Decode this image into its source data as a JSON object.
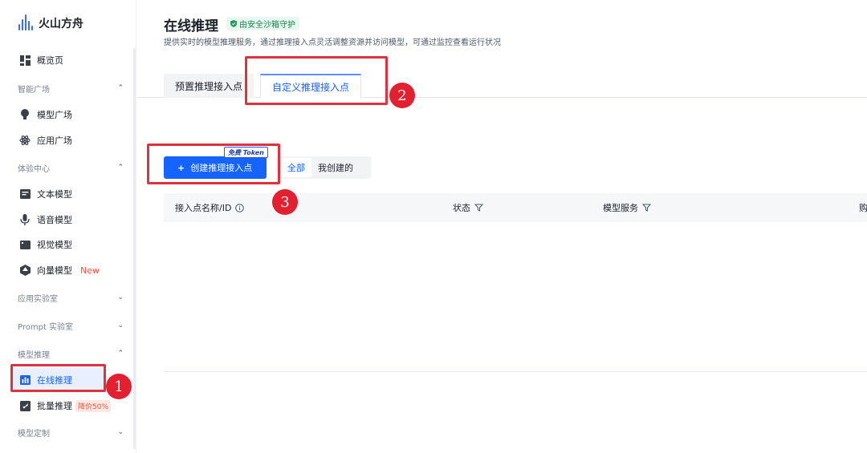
{
  "brand": {
    "name": "火山方舟"
  },
  "sidebar": {
    "overview": "概览页",
    "groups": [
      {
        "label": "智能广场",
        "chevron": "⌃"
      },
      {
        "label": "体验中心",
        "chevron": "⌃"
      },
      {
        "label": "应用实验室",
        "chevron": "⌄"
      },
      {
        "label": "Prompt 实验室",
        "chevron": "⌄"
      },
      {
        "label": "模型推理",
        "chevron": "⌃"
      },
      {
        "label": "模型定制",
        "chevron": "⌄"
      }
    ],
    "items": [
      {
        "label": "模型广场",
        "icon": "bulb-icon"
      },
      {
        "label": "应用广场",
        "icon": "atom-icon"
      },
      {
        "label": "文本模型",
        "icon": "text-box-icon"
      },
      {
        "label": "语音模型",
        "icon": "microphone-icon"
      },
      {
        "label": "视觉模型",
        "icon": "video-icon"
      },
      {
        "label": "向量模型",
        "icon": "vector-icon",
        "badge": "New"
      },
      {
        "label": "在线推理",
        "icon": "chart-icon",
        "active": true
      },
      {
        "label": "批量推理",
        "icon": "rocket-icon",
        "badge": "降价50%"
      }
    ]
  },
  "header": {
    "title": "在线推理",
    "security_tag": "由安全沙箱守护",
    "subtitle": "提供实时的模型推理服务，通过推理接入点灵活调整资源并访问模型，可通过监控查看运行状况"
  },
  "tabs": [
    {
      "label": "预置推理接入点",
      "active": false
    },
    {
      "label": "自定义推理接入点",
      "active": true
    }
  ],
  "toolbar": {
    "create_label": "创建推理接入点",
    "create_icon": "+",
    "free_token": "免费 Token",
    "filters": [
      {
        "label": "全部",
        "selected": true
      },
      {
        "label": "我创建的",
        "selected": false
      }
    ]
  },
  "table": {
    "columns": [
      {
        "label": "接入点名称/ID",
        "icon": "info-icon"
      },
      {
        "label": "状态",
        "icon": "filter-icon"
      },
      {
        "label": "模型服务",
        "icon": "filter-icon"
      },
      {
        "label": "购",
        "icon": ""
      }
    ]
  },
  "annotations": {
    "step1": "1",
    "step2": "2",
    "step3": "3"
  },
  "colors": {
    "primary": "#1664ff",
    "annotation_red": "#e0313f",
    "security_green": "#1e7f4f",
    "badge_red": "#f5533d"
  }
}
